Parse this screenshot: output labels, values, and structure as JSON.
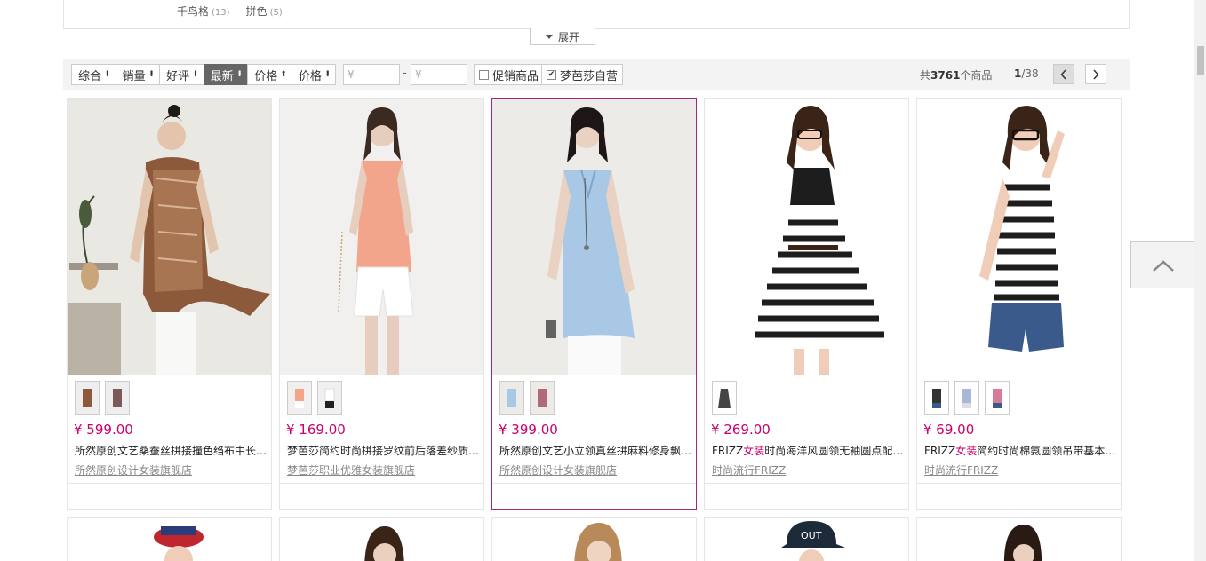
{
  "filter": {
    "values": [
      {
        "label": "千鸟格",
        "count": "(13)"
      },
      {
        "label": "拼色",
        "count": "(5)"
      }
    ],
    "expand_label": "展开"
  },
  "toolbar": {
    "sort_options": [
      {
        "label": "综合",
        "active": false
      },
      {
        "label": "销量",
        "active": false
      },
      {
        "label": "好评",
        "active": false
      },
      {
        "label": "最新",
        "active": true
      },
      {
        "label": "价格",
        "active": false
      },
      {
        "label": "价格",
        "active": false
      }
    ],
    "price_from_placeholder": "¥",
    "price_to_placeholder": "¥",
    "price_dash": "-",
    "promo_label": "促销商品",
    "promo_checked": false,
    "self_label": "梦芭莎自营",
    "self_checked": true,
    "total_prefix": "共",
    "total_count": "3761",
    "total_suffix": "个商品",
    "page_current": "1",
    "page_total": "/38"
  },
  "products": [
    {
      "price": "¥ 599.00",
      "title": "所然原创文艺桑蚕丝拼接撞色绉布中长…",
      "brand_highlight": "",
      "shop": "所然原创设计女装旗舰店",
      "thumb_count": 2
    },
    {
      "price": "¥ 169.00",
      "title": "梦芭莎简约时尚拼接罗纹前后落差纱质…",
      "brand_highlight": "",
      "shop": "梦芭莎职业优雅女装旗舰店",
      "thumb_count": 2
    },
    {
      "price": "¥ 399.00",
      "title": "所然原创文艺小立领真丝拼麻料修身飘…",
      "brand_highlight": "",
      "shop": "所然原创设计女装旗舰店",
      "thumb_count": 2
    },
    {
      "price": "¥ 269.00",
      "title_prefix": "FRIZZ",
      "title_em": "女装",
      "title_rest": "时尚海洋风圆领无袖圆点配…",
      "shop": "时尚流行FRIZZ",
      "thumb_count": 1
    },
    {
      "price": "¥ 69.00",
      "title_prefix": "FRIZZ",
      "title_em": "女装",
      "title_rest": "简约时尚棉氨圆领吊带基本…",
      "shop": "时尚流行FRIZZ",
      "thumb_count": 3
    }
  ],
  "icons": {
    "sort_arrow_down": "arrow-down-icon",
    "sort_arrow_up": "arrow-up-icon",
    "back_to_top": "chevron-up-icon"
  },
  "colors": {
    "price": "#c9006b",
    "active_sort_bg": "#666666",
    "highlight_border": "#a3267f"
  }
}
